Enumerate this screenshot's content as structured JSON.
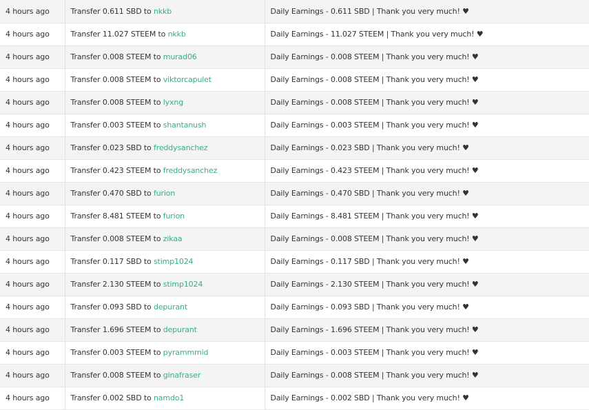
{
  "rows": [
    {
      "time": "4 hours ago",
      "transfer_text": "Transfer 0.611 SBD to",
      "recipient": "nkkb",
      "memo": "Daily Earnings - 0.611 SBD | Thank you very much! ♥"
    },
    {
      "time": "4 hours ago",
      "transfer_text": "Transfer 11.027 STEEM to",
      "recipient": "nkkb",
      "memo": "Daily Earnings - 11.027 STEEM | Thank you very much! ♥"
    },
    {
      "time": "4 hours ago",
      "transfer_text": "Transfer 0.008 STEEM to",
      "recipient": "murad06",
      "memo": "Daily Earnings - 0.008 STEEM | Thank you very much! ♥"
    },
    {
      "time": "4 hours ago",
      "transfer_text": "Transfer 0.008 STEEM to",
      "recipient": "viktorcapulet",
      "memo": "Daily Earnings - 0.008 STEEM | Thank you very much! ♥"
    },
    {
      "time": "4 hours ago",
      "transfer_text": "Transfer 0.008 STEEM to",
      "recipient": "lyxng",
      "memo": "Daily Earnings - 0.008 STEEM | Thank you very much! ♥"
    },
    {
      "time": "4 hours ago",
      "transfer_text": "Transfer 0.003 STEEM to",
      "recipient": "shantanush",
      "memo": "Daily Earnings - 0.003 STEEM | Thank you very much! ♥"
    },
    {
      "time": "4 hours ago",
      "transfer_text": "Transfer 0.023 SBD to",
      "recipient": "freddysanchez",
      "memo": "Daily Earnings - 0.023 SBD | Thank you very much! ♥"
    },
    {
      "time": "4 hours ago",
      "transfer_text": "Transfer 0.423 STEEM to",
      "recipient": "freddysanchez",
      "memo": "Daily Earnings - 0.423 STEEM | Thank you very much! ♥"
    },
    {
      "time": "4 hours ago",
      "transfer_text": "Transfer 0.470 SBD to",
      "recipient": "furion",
      "memo": "Daily Earnings - 0.470 SBD | Thank you very much! ♥"
    },
    {
      "time": "4 hours ago",
      "transfer_text": "Transfer 8.481 STEEM to",
      "recipient": "furion",
      "memo": "Daily Earnings - 8.481 STEEM | Thank you very much! ♥"
    },
    {
      "time": "4 hours ago",
      "transfer_text": "Transfer 0.008 STEEM to",
      "recipient": "zikaa",
      "memo": "Daily Earnings - 0.008 STEEM | Thank you very much! ♥"
    },
    {
      "time": "4 hours ago",
      "transfer_text": "Transfer 0.117 SBD to",
      "recipient": "stimp1024",
      "memo": "Daily Earnings - 0.117 SBD | Thank you very much! ♥"
    },
    {
      "time": "4 hours ago",
      "transfer_text": "Transfer 2.130 STEEM to",
      "recipient": "stimp1024",
      "memo": "Daily Earnings - 2.130 STEEM | Thank you very much! ♥"
    },
    {
      "time": "4 hours ago",
      "transfer_text": "Transfer 0.093 SBD to",
      "recipient": "depurant",
      "memo": "Daily Earnings - 0.093 SBD | Thank you very much! ♥"
    },
    {
      "time": "4 hours ago",
      "transfer_text": "Transfer 1.696 STEEM to",
      "recipient": "depurant",
      "memo": "Daily Earnings - 1.696 STEEM | Thank you very much! ♥"
    },
    {
      "time": "4 hours ago",
      "transfer_text": "Transfer 0.003 STEEM to",
      "recipient": "pyrammmid",
      "memo": "Daily Earnings - 0.003 STEEM | Thank you very much! ♥"
    },
    {
      "time": "4 hours ago",
      "transfer_text": "Transfer 0.008 STEEM to",
      "recipient": "ginafraser",
      "memo": "Daily Earnings - 0.008 STEEM | Thank you very much! ♥"
    },
    {
      "time": "4 hours ago",
      "transfer_text": "Transfer 0.002 SBD to",
      "recipient": "namdo1",
      "memo": "Daily Earnings - 0.002 SBD | Thank you very much! ♥"
    }
  ],
  "colors": {
    "link": "#3aab8a",
    "row_odd": "#f4f4f4",
    "row_even": "#ffffff",
    "text": "#333333"
  }
}
